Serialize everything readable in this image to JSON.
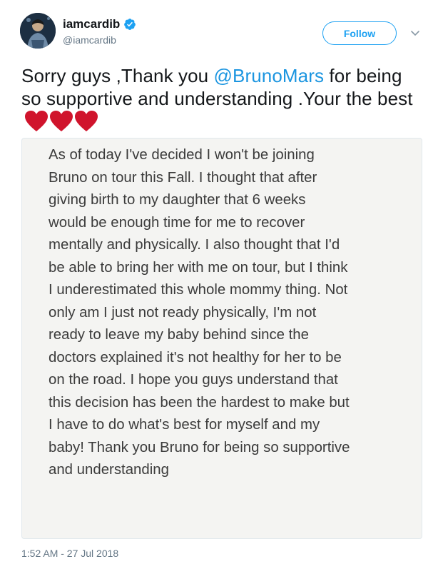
{
  "user": {
    "display_name": "iamcardib",
    "handle": "@iamcardib",
    "verified_icon": "verified-badge-icon",
    "avatar_icon": "profile-avatar"
  },
  "actions": {
    "follow_label": "Follow",
    "more_icon": "chevron-down-icon"
  },
  "tweet": {
    "text_before": "Sorry guys ,Thank you ",
    "mention": "@BrunoMars",
    "text_after": " for being so supportive and understanding .Your the best",
    "emoji": [
      "red-heart-icon",
      "red-heart-icon",
      "red-heart-icon"
    ]
  },
  "media": {
    "lines": [
      "As of today I've decided I won't be joining",
      "Bruno on tour this Fall. I thought that after",
      "giving birth to my daughter that 6 weeks",
      "would be enough time for me to recover",
      "mentally and physically. I also thought that I'd",
      "be able to bring her with me on tour, but I think",
      "I underestimated this whole mommy thing. Not",
      "only am I just not ready physically, I'm not",
      "ready to leave my baby behind since the",
      "doctors explained it's not healthy for her to be",
      "on the road. I hope you guys understand that",
      "this decision has been the hardest to make but",
      "I have to do what's best for myself and my",
      "baby! Thank you Bruno for being so supportive",
      "and understanding"
    ]
  },
  "timestamp": "1:52 AM - 27 Jul 2018",
  "colors": {
    "accent": "#1da1f2",
    "mention": "#1b95e0",
    "heart": "#d0142c",
    "secondary_text": "#657786"
  }
}
